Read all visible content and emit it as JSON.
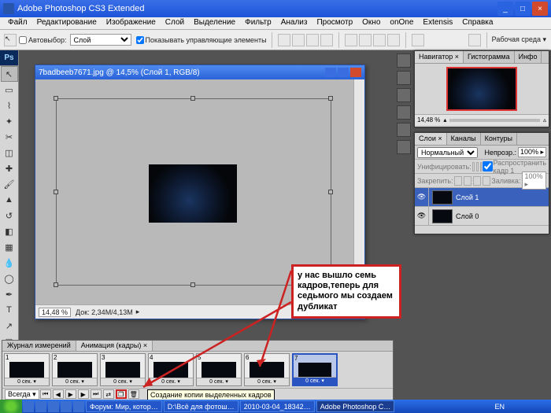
{
  "window": {
    "title": "Adobe Photoshop CS3 Extended",
    "min": "_",
    "max": "□",
    "close": "×"
  },
  "menu": [
    "Файл",
    "Редактирование",
    "Изображение",
    "Слой",
    "Выделение",
    "Фильтр",
    "Анализ",
    "Просмотр",
    "Окно",
    "onOne",
    "Extensis",
    "Справка"
  ],
  "options": {
    "autoselect_label": "Автовыбор:",
    "autoselect_value": "Слой",
    "show_controls": "Показывать управляющие элементы",
    "workspace": "Рабочая среда ▾"
  },
  "document": {
    "title": "7badbeeb7671.jpg @ 14,5% (Слой 1, RGB/8)",
    "zoom": "14,48 %",
    "docsize": "Док: 2,34M/4,13M"
  },
  "navigator": {
    "tabs": [
      "Навигатор ×",
      "Гистограмма",
      "Инфо"
    ],
    "zoom": "14,48 %"
  },
  "layers": {
    "tabs": [
      "Слои ×",
      "Каналы",
      "Контуры"
    ],
    "mode": "Нормальный",
    "opacity_label": "Непрозр.:",
    "opacity": "100% ▸",
    "unify": "Унифицировать:",
    "propagate": "Распространить кадр 1",
    "lock": "Закрепить:",
    "fill_label": "Заливка:",
    "fill": "100% ▸",
    "rows": [
      {
        "name": "Слой 1",
        "selected": true
      },
      {
        "name": "Слой 0",
        "selected": false
      }
    ]
  },
  "callout": "у нас вышло семь кадров,теперь для седьмого мы создаем дубликат",
  "animation": {
    "tabs": [
      "Журнал измерений",
      "Анимация (кадры) ×"
    ],
    "frames": [
      {
        "n": "1",
        "t": "0 сек."
      },
      {
        "n": "2",
        "t": "0 сек."
      },
      {
        "n": "3",
        "t": "0 сек."
      },
      {
        "n": "4",
        "t": "0 сек."
      },
      {
        "n": "5",
        "t": "0 сек."
      },
      {
        "n": "6",
        "t": "0 сек."
      },
      {
        "n": "7",
        "t": "0 сек.",
        "selected": true
      }
    ],
    "loop": "Всегда ▾",
    "tooltip": "Создание копии выделенных кадров"
  },
  "taskbar": {
    "tasks": [
      {
        "label": "Форум: Мир, котор…"
      },
      {
        "label": "D:\\Всё для фотош…"
      },
      {
        "label": "2010-03-04_18342…"
      },
      {
        "label": "Adobe Photoshop C…",
        "active": true
      }
    ],
    "lang": "EN"
  }
}
